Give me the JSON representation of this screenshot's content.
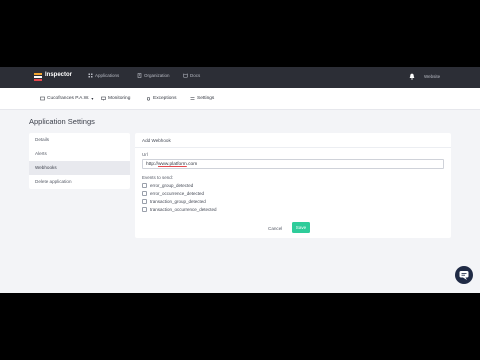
{
  "app": {
    "brand": "Inspector"
  },
  "top_nav": [
    {
      "label": "Applications",
      "icon": "grid-icon"
    },
    {
      "label": "Organization",
      "icon": "building-icon"
    },
    {
      "label": "Docs",
      "icon": "book-icon"
    }
  ],
  "top_right": {
    "bell_icon": "bell-icon",
    "website": "Website"
  },
  "sub_nav": {
    "app_selector": "Cucofrances P.A.W.",
    "monitoring": "Monitoring",
    "exceptions": "Exceptions",
    "settings": "Settings"
  },
  "page": {
    "title": "Application Settings"
  },
  "sidebar": {
    "items": [
      {
        "label": "Details",
        "active": false
      },
      {
        "label": "Alerts",
        "active": false
      },
      {
        "label": "Webhooks",
        "active": true
      },
      {
        "label": "Delete application",
        "active": false
      }
    ]
  },
  "form": {
    "title": "Add Webhook",
    "url_label": "Url",
    "url_prefix": "http://",
    "url_value_main": "www.platform",
    "url_suffix": ".com",
    "events_label": "Events to send:",
    "events": [
      {
        "label": "error_group_detected",
        "checked": false
      },
      {
        "label": "error_occurrence_detected",
        "checked": false
      },
      {
        "label": "transaction_group_detected",
        "checked": false
      },
      {
        "label": "transaction_occurrence_detected",
        "checked": false
      }
    ],
    "cancel_label": "Cancel",
    "save_label": "Save"
  },
  "colors": {
    "topbar": "#2c2e36",
    "accent_save": "#2ecc9a",
    "chat": "#1f2a45"
  }
}
